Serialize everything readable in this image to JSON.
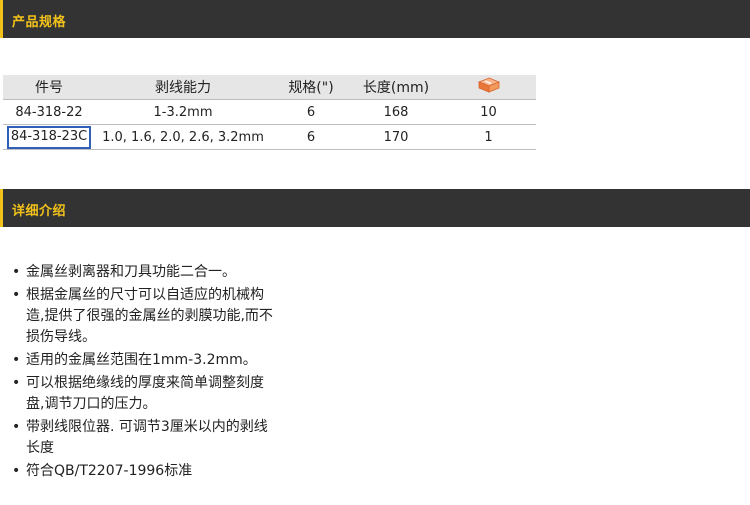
{
  "sections": {
    "spec_title": "产品规格",
    "detail_title": "详细介绍"
  },
  "table": {
    "headers": {
      "part": "件号",
      "capacity": "剥线能力",
      "size": "规格(\")",
      "length": "长度(mm)",
      "qty_icon": "package-box-icon"
    },
    "rows": [
      {
        "part": "84-318-22",
        "capacity": "1-3.2mm",
        "size": "6",
        "length": "168",
        "qty": "10"
      },
      {
        "part": "84-318-23C",
        "capacity": "1.0, 1.6, 2.0, 2.6, 3.2mm",
        "size": "6",
        "length": "170",
        "qty": "1"
      }
    ],
    "highlight_color": "#2f5fb8"
  },
  "features": [
    "金属丝剥离器和刀具功能二合一。",
    "根据金属丝的尺寸可以自适应的机械构造,提供了很强的金属丝的剥膜功能,而不损伤导线。",
    "适用的金属丝范围在1mm-3.2mm。",
    "可以根据绝缘线的厚度来简单调整刻度盘,调节刀口的压力。",
    "带剥线限位器. 可调节3厘米以内的剥线长度",
    "符合QB/T2207-1996标准"
  ],
  "colors": {
    "bar_bg": "#333333",
    "accent": "#f2c21b",
    "header_bg": "#e6e6e6"
  }
}
